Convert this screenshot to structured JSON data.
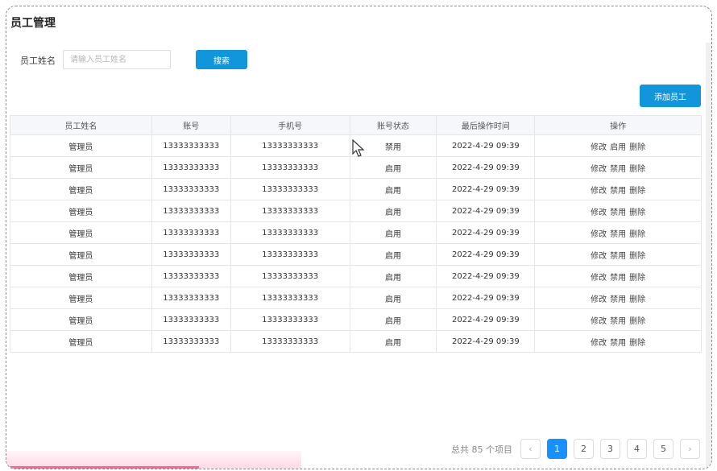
{
  "page": {
    "title": "员工管理"
  },
  "search": {
    "label": "员工姓名",
    "placeholder": "请输入员工姓名",
    "button": "搜索"
  },
  "actions": {
    "add_button": "添加员工"
  },
  "table": {
    "headers": [
      "员工姓名",
      "账号",
      "手机号",
      "账号状态",
      "最后操作时间",
      "操作"
    ],
    "rows": [
      {
        "name": "管理员",
        "account": "13333333333",
        "phone": "13333333333",
        "status": "禁用",
        "time": "2022-4-29 09:39",
        "ops": [
          "修改",
          "启用",
          "删除"
        ]
      },
      {
        "name": "管理员",
        "account": "13333333333",
        "phone": "13333333333",
        "status": "启用",
        "time": "2022-4-29 09:39",
        "ops": [
          "修改",
          "禁用",
          "删除"
        ]
      },
      {
        "name": "管理员",
        "account": "13333333333",
        "phone": "13333333333",
        "status": "启用",
        "time": "2022-4-29 09:39",
        "ops": [
          "修改",
          "禁用",
          "删除"
        ]
      },
      {
        "name": "管理员",
        "account": "13333333333",
        "phone": "13333333333",
        "status": "启用",
        "time": "2022-4-29 09:39",
        "ops": [
          "修改",
          "禁用",
          "删除"
        ]
      },
      {
        "name": "管理员",
        "account": "13333333333",
        "phone": "13333333333",
        "status": "启用",
        "time": "2022-4-29 09:39",
        "ops": [
          "修改",
          "禁用",
          "删除"
        ]
      },
      {
        "name": "管理员",
        "account": "13333333333",
        "phone": "13333333333",
        "status": "启用",
        "time": "2022-4-29 09:39",
        "ops": [
          "修改",
          "禁用",
          "删除"
        ]
      },
      {
        "name": "管理员",
        "account": "13333333333",
        "phone": "13333333333",
        "status": "启用",
        "time": "2022-4-29 09:39",
        "ops": [
          "修改",
          "禁用",
          "删除"
        ]
      },
      {
        "name": "管理员",
        "account": "13333333333",
        "phone": "13333333333",
        "status": "启用",
        "time": "2022-4-29 09:39",
        "ops": [
          "修改",
          "禁用",
          "删除"
        ]
      },
      {
        "name": "管理员",
        "account": "13333333333",
        "phone": "13333333333",
        "status": "启用",
        "time": "2022-4-29 09:39",
        "ops": [
          "修改",
          "禁用",
          "删除"
        ]
      },
      {
        "name": "管理员",
        "account": "13333333333",
        "phone": "13333333333",
        "status": "启用",
        "time": "2022-4-29 09:39",
        "ops": [
          "修改",
          "禁用",
          "删除"
        ]
      }
    ]
  },
  "pagination": {
    "total_text": "总共 85 个项目",
    "pages": [
      "1",
      "2",
      "3",
      "4",
      "5"
    ],
    "current": "1",
    "prev_icon": "chevron-left-icon",
    "next_icon": "chevron-right-icon",
    "prev_glyph": "‹",
    "next_glyph": "›"
  },
  "colors": {
    "primary": "#1296db",
    "active_page": "#1890ff"
  }
}
